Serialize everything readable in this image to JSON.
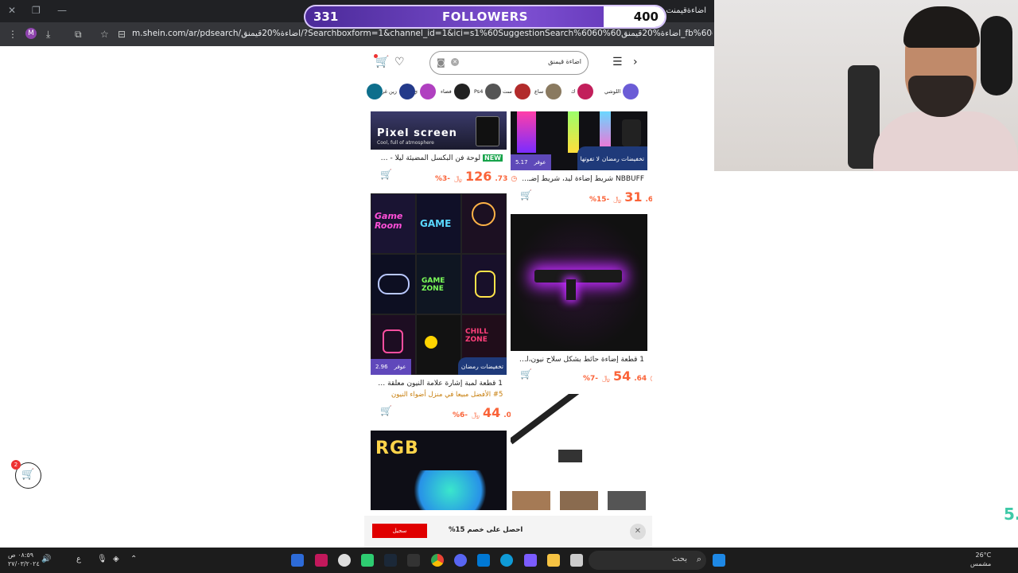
{
  "browser": {
    "tab_title": "اضاءةقيمنت : ...",
    "url": "m.shein.com/ar/pdsearch/اضاءة%20قيمنق/?Searchboxform=1&channel_id=1&ici=s1%60SuggestionSearch%6060%60اضاءة%20قيمنق_fb%60d0%60PageHome&search_source=2&",
    "profile_initial": "M"
  },
  "followers": {
    "current": "331",
    "label": "FOLLOWERS",
    "goal": "400",
    "progress": 0.83
  },
  "search": {
    "query": "اضاءة قيمنق"
  },
  "chips": [
    {
      "label": "اللوشي",
      "color": "#6b5cd6"
    },
    {
      "label": "ك",
      "color": "#c21f5b"
    },
    {
      "label": "ساع",
      "color": "#8a7a60"
    },
    {
      "label": "ست",
      "color": "#b22b2b"
    },
    {
      "label": "Ps4",
      "color": "#555"
    },
    {
      "label": "فضاء",
      "color": "#222"
    },
    {
      "label": "ي",
      "color": "#b040c0"
    },
    {
      "label": "زين غرف نوم",
      "color": "#243a8a"
    },
    {
      "label": "",
      "color": "#0e6f8c"
    }
  ],
  "products": {
    "p1": {
      "banner": "Pixel screen",
      "banner_sub": "Cool, full of atmosphere",
      "badge": "NEW",
      "title": "لوحة فن البكسل المضيئة ليلًا - شا...",
      "price_int": "126",
      "price_dec": ".73",
      "discount": "%3-"
    },
    "p2": {
      "title": "NBBUFF شريط إضاءة ليد، شريط إضـ...",
      "price_int": "31",
      "price_dec": ".63",
      "discount": "%15-",
      "strip_price": "5.17",
      "strip_note": "لا تفوتها"
    },
    "p3": {
      "title": "1 قطعة لمبة إشارة علامة النيون معلقة ديك...",
      "rank": "#5 الأفضل مبيعا في منزل أضواء النيون",
      "price_int": "44",
      "price_dec": ".04",
      "discount": "%6-",
      "strip_price": "2.96",
      "sign_texts": [
        "Game Room",
        "GAME",
        "GAME ZONE",
        "CHILL ZONE"
      ]
    },
    "p4": {
      "title": "1 قطعة إضاءة حائط بشكل سلاح نيون،لل...",
      "price_int": "54",
      "price_dec": ".64",
      "discount": "%7-"
    },
    "p5": {
      "banner": "RGB"
    }
  },
  "ramadan_label": "تخفيضات رمضان",
  "strip_prefix": "عوفر",
  "promo": {
    "text": "احصل على خصم 15%",
    "button": "سجيل"
  },
  "floating_cart_count": "2",
  "side_number": "5.",
  "taskbar": {
    "search_label": "بحث",
    "time": "٠٨:٥٩ ص",
    "date": "٢٧/٠٣/٢٠٢٤",
    "lang": "ع",
    "temp": "26°C",
    "weather": "مشمس"
  },
  "colors": {
    "brand_price": "#fa6338",
    "followers_purple": "#7d4fd1",
    "promo_red": "#e00000"
  }
}
